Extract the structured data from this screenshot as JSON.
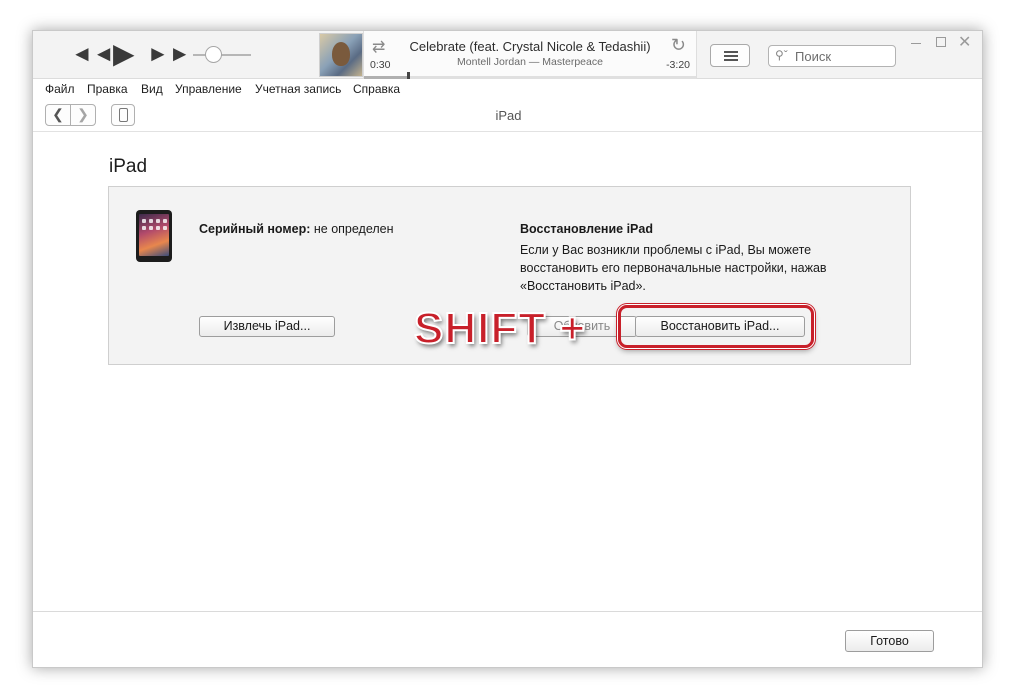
{
  "player": {
    "song_title": "Celebrate (feat. Crystal Nicole & Tedashii)",
    "song_artist": "Montell Jordan — Masterpeace",
    "time_elapsed": "0:30",
    "time_remaining": "-3:20",
    "progress_fraction": 0.13,
    "volume_fraction": 0.35,
    "search_placeholder": "Поиск"
  },
  "menu": {
    "items": [
      "Файл",
      "Правка",
      "Вид",
      "Управление",
      "Учетная запись",
      "Справка"
    ]
  },
  "nav": {
    "title": "iPad"
  },
  "content": {
    "page_title": "iPad",
    "serial_label": "Серийный номер:",
    "serial_value": "не определен",
    "restore_title": "Восстановление iPad",
    "restore_desc": "Если у Вас возникли проблемы с iPad, Вы можете восстановить его первоначальные настройки, нажав «Восстановить iPad».",
    "eject_button": "Извлечь iPad...",
    "update_button": "Обновить",
    "restore_button": "Восстановить iPad...",
    "overlay_text": "SHIFT +"
  },
  "footer": {
    "done_button": "Готово"
  },
  "colors": {
    "highlight": "#c8202a"
  }
}
